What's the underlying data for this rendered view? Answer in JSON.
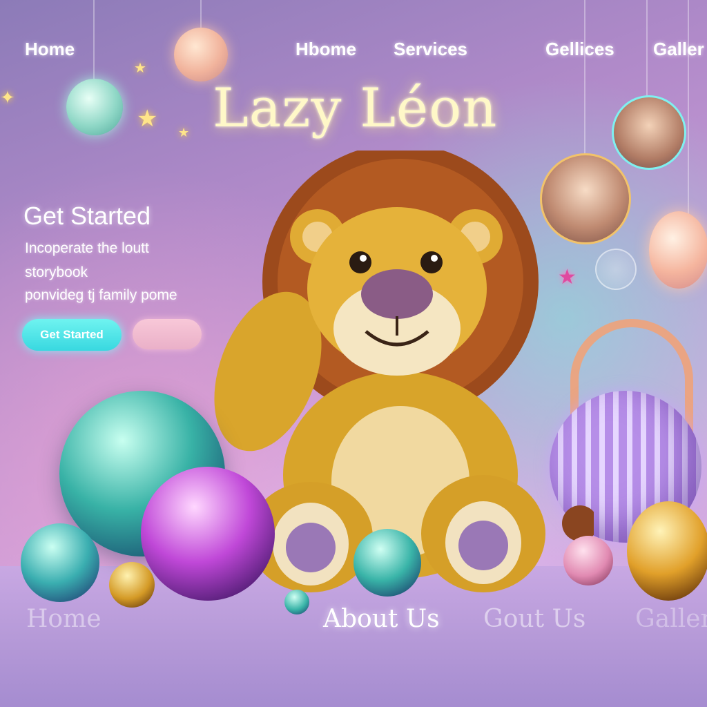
{
  "nav": {
    "items": [
      {
        "label": "Home"
      },
      {
        "label": "Home",
        "printed": "Hbome"
      },
      {
        "label": "Services"
      },
      {
        "label": "Gellices"
      },
      {
        "label": "Galler"
      }
    ]
  },
  "hero": {
    "title": "Lazy Léon",
    "heading": "Get Started",
    "text_lines": [
      "Incoperate the loutt",
      "storybook",
      "ponvideg tj family pome"
    ],
    "primary_button": "Get Started"
  },
  "footer_nav": {
    "items": [
      "Home",
      "About Us",
      "About Us",
      "Galler"
    ],
    "printed": [
      "Home",
      "About Us",
      "Gout Us",
      "Galler"
    ]
  },
  "colors": {
    "title": "#fff8c8",
    "primary_button": "#45e0e6",
    "secondary_button": "#f2bcd2",
    "background": "#b08ac9"
  }
}
